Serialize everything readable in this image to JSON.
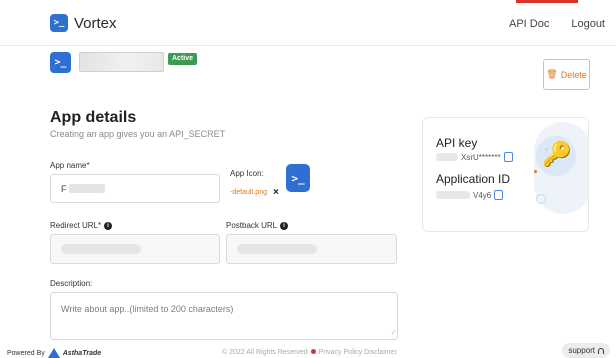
{
  "brand": {
    "name": "Vortex",
    "logo_glyph": ">_",
    "logo_color": "#2f6fd1"
  },
  "nav": {
    "api_doc": "API Doc",
    "logout": "Logout",
    "strip_color": "#d8342b"
  },
  "app": {
    "avatar_glyph": ">_",
    "status": "Active",
    "status_color": "#3c9a52"
  },
  "delete_button": {
    "label": "Delete",
    "color": "#e07a1c"
  },
  "details": {
    "title": "App details",
    "subtitle": "Creating an app gives you an API_SECRET"
  },
  "form": {
    "app_name": {
      "label": "App name*",
      "value": "F"
    },
    "app_icon": {
      "label": "App Icon:",
      "file": "default.png",
      "remove": "×",
      "preview_glyph": ">_"
    },
    "redirect_url": {
      "label": "Redirect URL*"
    },
    "postback_url": {
      "label": "Postback URL"
    },
    "description": {
      "label": "Description:",
      "placeholder": "Write about app..(limited to 200 characters)"
    }
  },
  "credentials": {
    "api_key": {
      "title": "API key",
      "value": "XsrU*******"
    },
    "app_id": {
      "title": "Application ID",
      "value": "V4y6"
    }
  },
  "footer": {
    "powered_by": "Powered By",
    "company": "AsthaTrade",
    "copyright": "© 2022 All Rights Reserved",
    "privacy": "Privacy Policy",
    "disclaimer": "Disclaimer",
    "support": "support"
  },
  "colors": {
    "accent": "#2f6fd1",
    "orange": "#e07a1c"
  }
}
